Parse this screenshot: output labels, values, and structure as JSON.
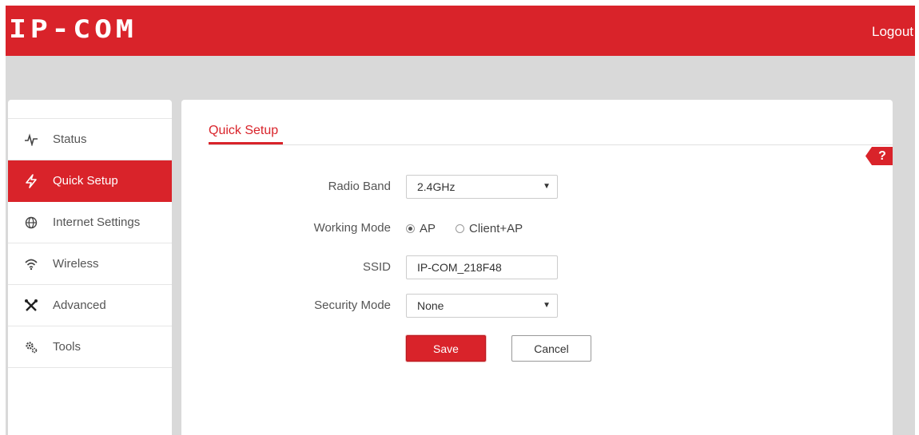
{
  "header": {
    "logo": "IP-COM",
    "logout_label": "Logout"
  },
  "sidebar": {
    "items": [
      {
        "label": "Status",
        "icon": "pulse-icon",
        "active": false
      },
      {
        "label": "Quick Setup",
        "icon": "lightning-icon",
        "active": true
      },
      {
        "label": "Internet Settings",
        "icon": "globe-icon",
        "active": false
      },
      {
        "label": "Wireless",
        "icon": "wifi-icon",
        "active": false
      },
      {
        "label": "Advanced",
        "icon": "tools-icon",
        "active": false
      },
      {
        "label": "Tools",
        "icon": "gears-icon",
        "active": false
      }
    ]
  },
  "main": {
    "tab_title": "Quick Setup",
    "help_label": "?",
    "form": {
      "radio_band": {
        "label": "Radio Band",
        "value": "2.4GHz"
      },
      "working_mode": {
        "label": "Working Mode",
        "options": [
          "AP",
          "Client+AP"
        ],
        "selected": "AP"
      },
      "ssid": {
        "label": "SSID",
        "value": "IP-COM_218F48"
      },
      "security_mode": {
        "label": "Security Mode",
        "value": "None"
      }
    },
    "buttons": {
      "save": "Save",
      "cancel": "Cancel"
    }
  },
  "colors": {
    "brand_red": "#d9232a",
    "background_gray": "#d9d9d9"
  }
}
